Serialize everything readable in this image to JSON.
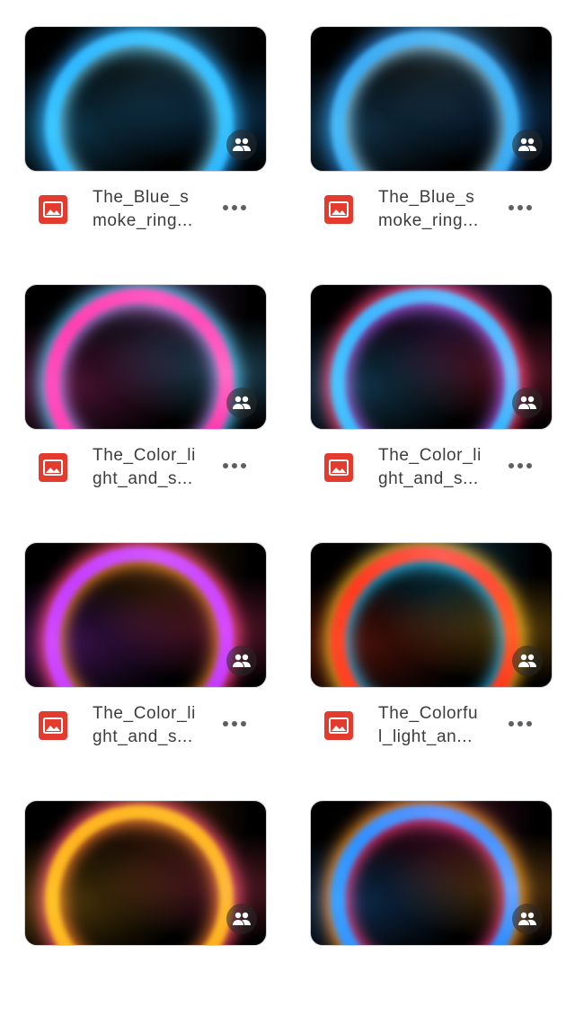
{
  "files": [
    {
      "name_line1": "The_Blue_s",
      "name_line2": "moke_ring...",
      "thumb_colors": [
        "#2fb7ff",
        "#1f8fe0",
        "#67d5ff"
      ],
      "shared_icon": "people-icon",
      "file_type_icon": "image-icon",
      "more_icon": "more-horizontal-icon"
    },
    {
      "name_line1": "The_Blue_s",
      "name_line2": "moke_ring...",
      "thumb_colors": [
        "#3aa9f2",
        "#1d6fbf",
        "#8fd8ff"
      ],
      "shared_icon": "people-icon",
      "file_type_icon": "image-icon",
      "more_icon": "more-horizontal-icon"
    },
    {
      "name_line1": "The_Color_li",
      "name_line2": "ght_and_s...",
      "thumb_colors": [
        "#ff3fb0",
        "#58c7ff",
        "#c98cff"
      ],
      "shared_icon": "people-icon",
      "file_type_icon": "image-icon",
      "more_icon": "more-horizontal-icon"
    },
    {
      "name_line1": "The_Color_li",
      "name_line2": "ght_and_s...",
      "thumb_colors": [
        "#3bb6ff",
        "#ff3d6e",
        "#b05cff"
      ],
      "shared_icon": "people-icon",
      "file_type_icon": "image-icon",
      "more_icon": "more-horizontal-icon"
    },
    {
      "name_line1": "The_Color_li",
      "name_line2": "ght_and_s...",
      "thumb_colors": [
        "#c43cff",
        "#ff3d7a",
        "#ff8a2b"
      ],
      "shared_icon": "people-icon",
      "file_type_icon": "image-icon",
      "more_icon": "more-horizontal-icon"
    },
    {
      "name_line1": "The_Colorfu",
      "name_line2": "l_light_an...",
      "thumb_colors": [
        "#ff3a1e",
        "#ffb21e",
        "#2ec6ff"
      ],
      "shared_icon": "people-icon",
      "file_type_icon": "image-icon",
      "more_icon": "more-horizontal-icon"
    },
    {
      "name_line1": "",
      "name_line2": "",
      "thumb_colors": [
        "#ffb21e",
        "#ff4d6a",
        "#ff7a2b"
      ],
      "shared_icon": "people-icon",
      "file_type_icon": "image-icon",
      "more_icon": "more-horizontal-icon"
    },
    {
      "name_line1": "",
      "name_line2": "",
      "thumb_colors": [
        "#2f8fff",
        "#ff9a2b",
        "#ff3d8a"
      ],
      "shared_icon": "people-icon",
      "file_type_icon": "image-icon",
      "more_icon": "more-horizontal-icon"
    }
  ],
  "colors": {
    "file_icon_bg": "#e33b2e",
    "text": "#3c3c3f",
    "dots": "#5f5f63"
  }
}
